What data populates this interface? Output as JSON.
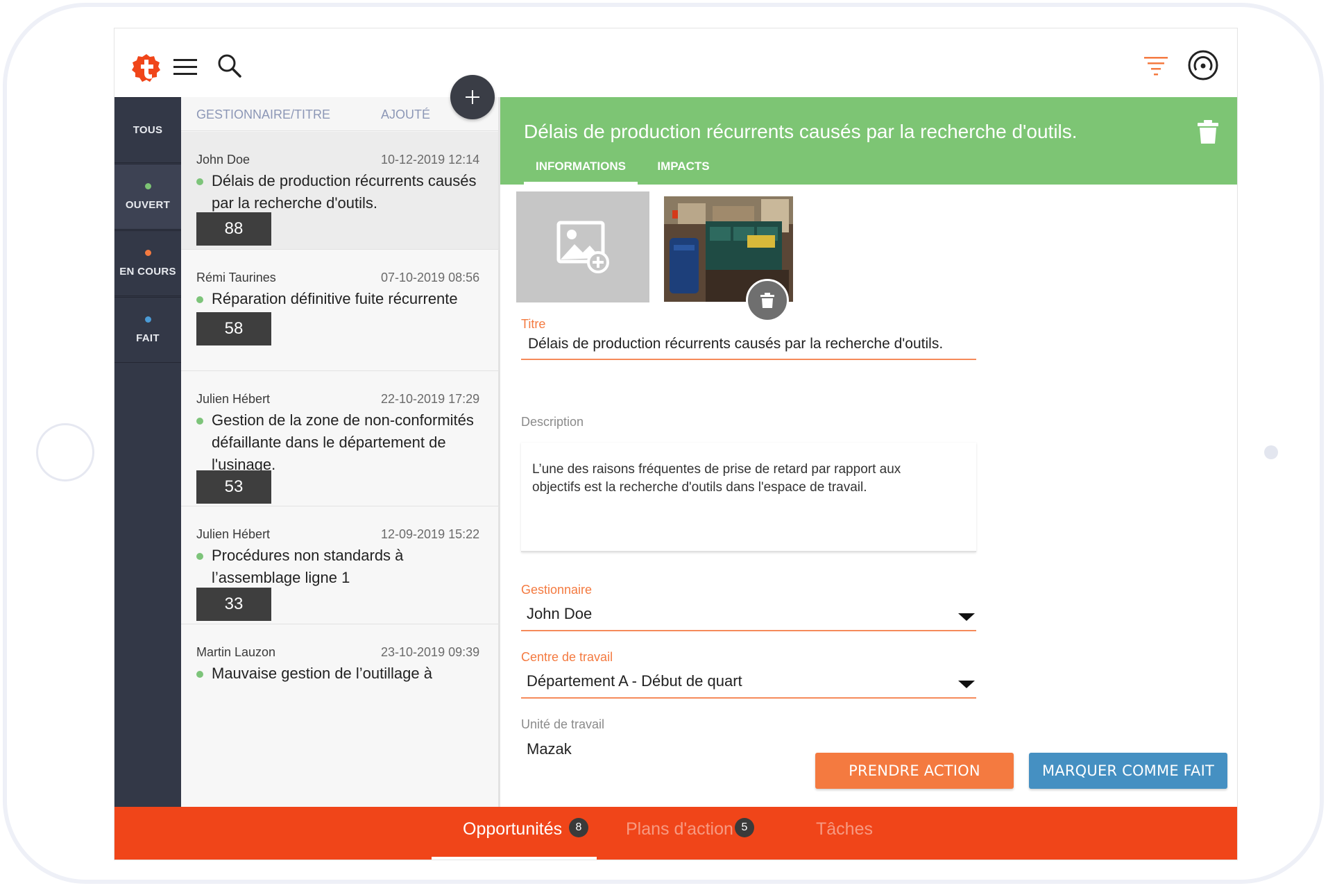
{
  "sidebar": {
    "statuses": [
      {
        "label": "TOUS",
        "dot_color": ""
      },
      {
        "label": "OUVERT",
        "dot_color": "#7dc474"
      },
      {
        "label": "EN COURS",
        "dot_color": "#f47a40"
      },
      {
        "label": "FAIT",
        "dot_color": "#4b9bd6"
      }
    ]
  },
  "list": {
    "header_title": "GESTIONNAIRE/TITRE",
    "header_added": "AJOUTÉ",
    "items": [
      {
        "name": "John Doe",
        "date": "10-12-2019 12:14",
        "title": "Délais de production récurrents causés par la recherche d'outils.",
        "score": "88"
      },
      {
        "name": "Rémi Taurines",
        "date": "07-10-2019 08:56",
        "title": "Réparation définitive fuite récurrente",
        "score": "58"
      },
      {
        "name": "Julien Hébert",
        "date": "22-10-2019 17:29",
        "title": "Gestion de la zone de non-conformités défaillante dans le département de l'usinage.",
        "score": "53"
      },
      {
        "name": "Julien Hébert",
        "date": "12-09-2019 15:22",
        "title": "Procédures non standards à l’assemblage ligne 1",
        "score": "33"
      },
      {
        "name": "Martin Lauzon",
        "date": "23-10-2019 09:39",
        "title": "Mauvaise gestion de l’outillage à",
        "score": ""
      }
    ]
  },
  "detail": {
    "title": "Délais de production récurrents causés par la recherche d'outils.",
    "tabs": [
      "INFORMATIONS",
      "IMPACTS"
    ],
    "fields": {
      "titre_label": "Titre",
      "titre_value": "Délais de production récurrents causés par la recherche d'outils.",
      "description_label": "Description",
      "description_value": "L’une des raisons fréquentes de prise de retard par rapport aux objectifs est la recherche d'outils dans l'espace de travail.",
      "gestionnaire_label": "Gestionnaire",
      "gestionnaire_value": "John Doe",
      "centre_label": "Centre de travail",
      "centre_value": "Département A - Début de quart",
      "unite_label": "Unité de travail",
      "unite_value": "Mazak"
    },
    "buttons": {
      "take_action": "PRENDRE ACTION",
      "mark_done": "MARQUER COMME FAIT"
    }
  },
  "bottom_nav": {
    "tabs": [
      {
        "label": "Opportunités",
        "badge": "8"
      },
      {
        "label": "Plans d'action",
        "badge": "5"
      },
      {
        "label": "Tâches",
        "badge": ""
      }
    ]
  },
  "colors": {
    "accent_orange": "#f04519",
    "header_green": "#7dc574",
    "sidebar_dark": "#333847",
    "button_blue": "#4590c2",
    "button_orange": "#f47a40"
  }
}
